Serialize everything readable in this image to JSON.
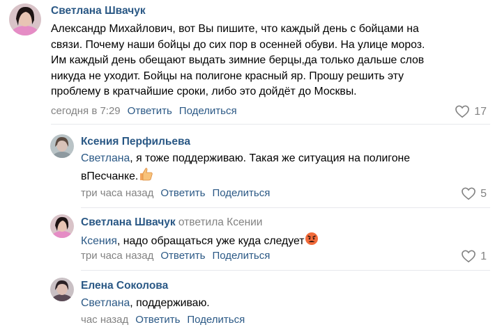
{
  "comments": [
    {
      "author": "Светлана Швачук",
      "lines": [
        "Александр Михайлович, вот Вы пишите, что каждый день с бойцами на",
        "связи. Почему наши бойцы до сих пор в осенней обуви. На улице мороз.",
        "Им каждый день обещают выдать зимние берцы,да только дальше слов",
        "никуда не уходит. Бойцы на полигоне красный яр. Прошу решить эту",
        "проблему в кратчайшие сроки, либо это дойдёт до Москвы."
      ],
      "time": "сегодня в 7:29",
      "reply": "Ответить",
      "share": "Поделиться",
      "likes": "17"
    },
    {
      "author": "Ксения Перфильева",
      "mention": "Светлана",
      "lines": [
        ", я тоже поддерживаю. Такая же ситуация на полигоне",
        "вПесчанке."
      ],
      "emoji": "thumbs-up",
      "time": "три часа назад",
      "reply": "Ответить",
      "share": "Поделиться",
      "likes": "5"
    },
    {
      "author": "Светлана Швачук",
      "reply_to": "ответила Ксении",
      "mention": "Ксения",
      "lines": [
        ", надо обращаться уже куда следует"
      ],
      "emoji": "angry-face",
      "time": "три часа назад",
      "reply": "Ответить",
      "share": "Поделиться",
      "likes": "1"
    },
    {
      "author": "Елена Соколова",
      "mention": "Светлана",
      "lines": [
        ", поддерживаю."
      ],
      "time": "час назад",
      "reply": "Ответить",
      "share": "Поделиться"
    }
  ],
  "colors": {
    "link": "#2a5885",
    "meta": "#828282",
    "divider": "#e7e8ec"
  }
}
